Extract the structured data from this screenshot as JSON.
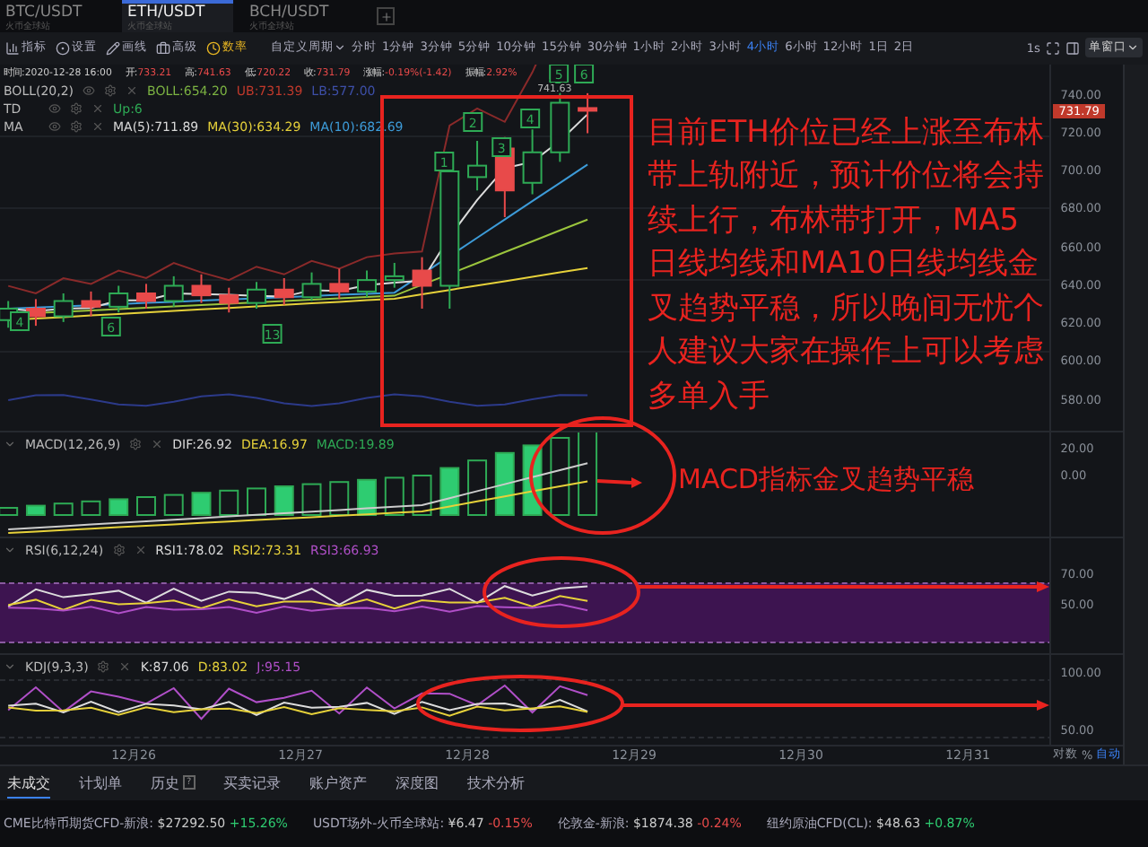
{
  "tabs": [
    {
      "pair": "BTC/USDT",
      "exchange": "火币全球站",
      "selected": false
    },
    {
      "pair": "ETH/USDT",
      "exchange": "火币全球站",
      "selected": true
    },
    {
      "pair": "BCH/USDT",
      "exchange": "火币全球站",
      "selected": false
    }
  ],
  "toolbar": {
    "tools": [
      {
        "label": "指标",
        "kind": "indicator"
      },
      {
        "label": "设置",
        "kind": "settings"
      },
      {
        "label": "画线",
        "kind": "draw"
      },
      {
        "label": "高级",
        "kind": "advanced"
      },
      {
        "label": "数率",
        "kind": "rate"
      }
    ],
    "custom_period": "自定义周期",
    "periods": [
      {
        "label": "分时",
        "selected": false
      },
      {
        "label": "1分钟",
        "selected": false
      },
      {
        "label": "3分钟",
        "selected": false
      },
      {
        "label": "5分钟",
        "selected": false
      },
      {
        "label": "10分钟",
        "selected": false
      },
      {
        "label": "15分钟",
        "selected": false
      },
      {
        "label": "30分钟",
        "selected": false
      },
      {
        "label": "1小时",
        "selected": false
      },
      {
        "label": "2小时",
        "selected": false
      },
      {
        "label": "3小时",
        "selected": false
      },
      {
        "label": "4小时",
        "selected": true
      },
      {
        "label": "6小时",
        "selected": false
      },
      {
        "label": "12小时",
        "selected": false
      },
      {
        "label": "1日",
        "selected": false
      },
      {
        "label": "2日",
        "selected": false
      }
    ],
    "speed": "1s",
    "window_mode": "单窗口"
  },
  "quote": [
    {
      "label": "时间:",
      "value": "2020-12-28 16:00",
      "kind": "time"
    },
    {
      "label": "开:",
      "value": "733.21",
      "kind": "price"
    },
    {
      "label": "高:",
      "value": "741.63",
      "kind": "price"
    },
    {
      "label": "低:",
      "value": "720.22",
      "kind": "price"
    },
    {
      "label": "收:",
      "value": "731.79",
      "kind": "price"
    },
    {
      "label": "涨幅:",
      "value": "-0.19%(-1.42)",
      "kind": "price"
    },
    {
      "label": "振幅:",
      "value": "2.92%",
      "kind": "price"
    }
  ],
  "main_indicators": [
    {
      "name": "BOLL(20,2)",
      "values": [
        {
          "text": "BOLL:654.20",
          "color": "#7cb342"
        },
        {
          "text": "UB:731.39",
          "color": "#c0392b"
        },
        {
          "text": "LB:577.00",
          "color": "#3d4fa8"
        }
      ]
    },
    {
      "name": "TD",
      "values": [
        {
          "text": "Up:6",
          "color": "#2eaa55"
        }
      ]
    },
    {
      "name": "MA",
      "values": [
        {
          "text": "MA(5):711.89",
          "color": "#d8d8d8"
        },
        {
          "text": "MA(30):634.29",
          "color": "#e6d13a"
        },
        {
          "text": "MA(10):682.69",
          "color": "#3d9bd8"
        }
      ]
    }
  ],
  "td_markers": [
    "4",
    "6",
    "13",
    "1",
    "2",
    "3",
    "4",
    "5",
    "6"
  ],
  "high_label": "741.63",
  "price_axis": {
    "labels": [
      "740.00",
      "720.00",
      "700.00",
      "680.00",
      "660.00",
      "640.00",
      "620.00",
      "600.00",
      "580.00"
    ],
    "last_price": "731.79"
  },
  "sub_panes": [
    {
      "name": "MACD(12,26,9)",
      "values": [
        {
          "text": "DIF:26.92",
          "color": "#d8d8d8"
        },
        {
          "text": "DEA:16.97",
          "color": "#e6d13a"
        },
        {
          "text": "MACD:19.89",
          "color": "#2eaa55"
        }
      ],
      "axis": [
        "20.00",
        "0.00"
      ]
    },
    {
      "name": "RSI(6,12,24)",
      "values": [
        {
          "text": "RSI1:78.02",
          "color": "#d8d8d8"
        },
        {
          "text": "RSI2:73.31",
          "color": "#e6d13a"
        },
        {
          "text": "RSI3:66.93",
          "color": "#b04fc8"
        }
      ],
      "axis": [
        "70.00",
        "50.00"
      ]
    },
    {
      "name": "KDJ(9,3,3)",
      "values": [
        {
          "text": "K:87.06",
          "color": "#d8d8d8"
        },
        {
          "text": "D:83.02",
          "color": "#e6d13a"
        },
        {
          "text": "J:95.15",
          "color": "#b04fc8"
        }
      ],
      "axis": [
        "100.00",
        "50.00"
      ]
    }
  ],
  "dates": [
    "12月26",
    "12月27",
    "12月28",
    "12月29",
    "12月30",
    "12月31"
  ],
  "axis_options": [
    {
      "label": "对数",
      "selected": false
    },
    {
      "label": "%",
      "selected": false
    },
    {
      "label": "自动",
      "selected": true
    }
  ],
  "annotation": {
    "main": "目前ETH价位已经上涨至布林带上轨附近，预计价位将会持续上行，布林带打开，MA5日线均线和MA10日线均线金叉趋势平稳，所以晚间无忧个人建议大家在操作上可以考虑多单入手",
    "macd": "MACD指标金叉趋势平稳"
  },
  "bottom_tabs": [
    {
      "label": "未成交",
      "selected": true
    },
    {
      "label": "计划单",
      "selected": false
    },
    {
      "label": "历史",
      "selected": false,
      "help": "?"
    },
    {
      "label": "买卖记录",
      "selected": false
    },
    {
      "label": "账户资产",
      "selected": false
    },
    {
      "label": "深度图",
      "selected": false
    },
    {
      "label": "技术分析",
      "selected": false
    }
  ],
  "ticker": [
    {
      "name": "CME比特币期货CFD-新浪:",
      "price": "$27292.50",
      "change": "+15.26%",
      "color": "#2ecc71"
    },
    {
      "name": "USDT场外-火币全球站:",
      "price": "¥6.47",
      "change": "-0.15%",
      "color": "#e84a4a"
    },
    {
      "name": "伦敦金-新浪:",
      "price": "$1874.38",
      "change": "-0.24%",
      "color": "#e84a4a"
    },
    {
      "name": "纽约原油CFD(CL):",
      "price": "$48.63",
      "change": "+0.87%",
      "color": "#2ecc71"
    }
  ]
}
